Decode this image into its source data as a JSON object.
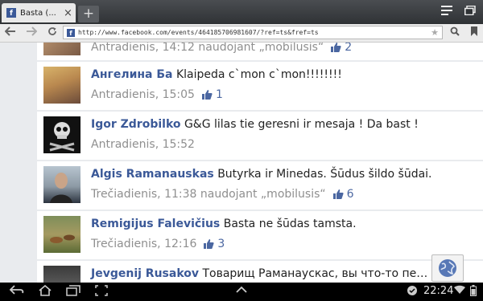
{
  "browser": {
    "tab_title": "Basta (...",
    "tab_close": "×",
    "new_tab": "+",
    "url": "http://www.facebook.com/events/464185706981607/?ref=ts&fref=ts",
    "favicon_letter": "f"
  },
  "posts": [
    {
      "author": "",
      "text": "",
      "time": "Antradienis, 14:12 naudojant „mobilusis“",
      "likes": "2"
    },
    {
      "author": "Ангелина Ба",
      "text": "Klaipeda c`mon c`mon!!!!!!!!",
      "time": "Antradienis, 15:05",
      "likes": "1"
    },
    {
      "author": "Igor Zdrobilko",
      "text": "G&G lilas tie geresni ir mesaja ! Da bast !",
      "time": "Antradienis, 15:52",
      "likes": ""
    },
    {
      "author": "Algis Ramanauskas",
      "text": "Butyrka ir Minedas. Šūdus šildo šūdai.",
      "time": "Trečiadienis, 11:38 naudojant „mobilusis“",
      "likes": "6"
    },
    {
      "author": "Remigijus Falevičius",
      "text": "Basta ne šūdas tamsta.",
      "time": "Trečiadienis, 12:16",
      "likes": "3"
    },
    {
      "author": "Jevgenij Rusakov",
      "text": "Товарищ Раманаускас, вы что-то пе… тал",
      "time": "",
      "likes": ""
    }
  ],
  "status_bar": {
    "time": "22:24"
  },
  "icons": {
    "menu": "menu-icon",
    "window": "window-icon",
    "back": "back-arrow-icon",
    "forward": "forward-arrow-icon",
    "refresh": "refresh-icon",
    "search": "search-icon",
    "bookmark": "bookmark-icon",
    "like": "thumbs-up-icon",
    "globe": "globe-icon"
  },
  "colors": {
    "author": "#3b5998",
    "meta": "#8f8f8f",
    "like": "#4b67a1",
    "background": "#e9ebee"
  }
}
